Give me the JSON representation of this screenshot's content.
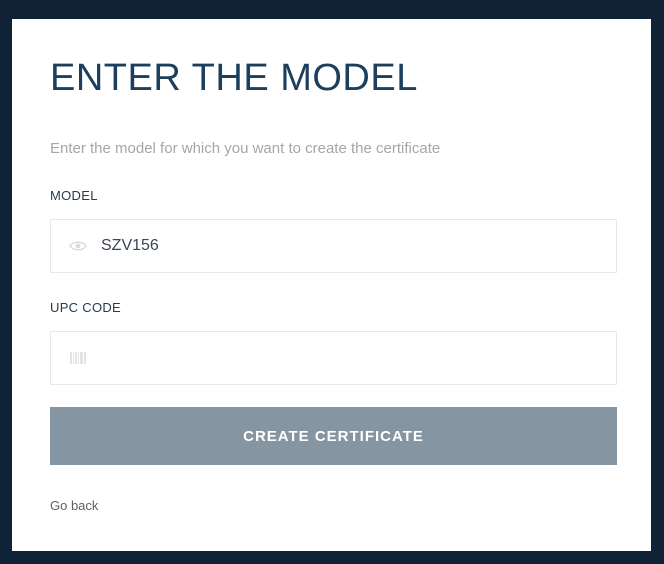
{
  "page": {
    "title": "ENTER THE MODEL",
    "subtitle": "Enter the model for which you want to create the certificate"
  },
  "form": {
    "model": {
      "label": "MODEL",
      "value": "SZV156",
      "icon": "eye-icon"
    },
    "upc": {
      "label": "UPC CODE",
      "value": "",
      "icon": "barcode-icon"
    },
    "submit_label": "CREATE CERTIFICATE"
  },
  "nav": {
    "back_label": "Go back"
  },
  "colors": {
    "background": "#0f2236",
    "title": "#1c3f5e",
    "button": "#8595a1"
  }
}
